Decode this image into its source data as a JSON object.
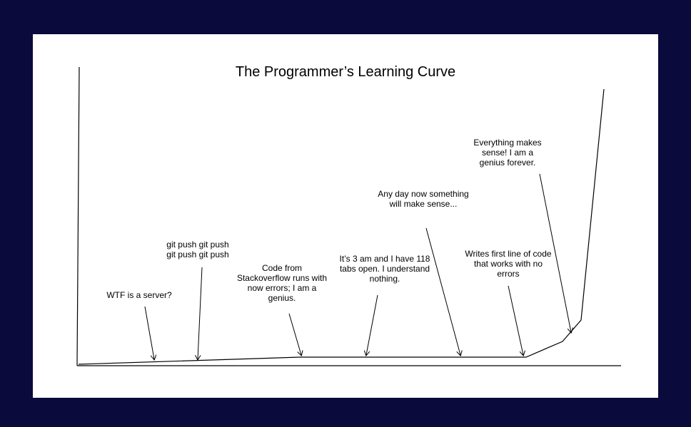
{
  "title": "The Programmer’s Learning Curve",
  "annotations": [
    "WTF is a server?",
    "git push git push\ngit push git push",
    "Code from\nStackoverflow runs with\nnow errors; I am a\ngenius.",
    "It’s 3 am and I have 118\ntabs open. I understand\nnothing.",
    "Any day now something\nwill make sense...",
    "Writes first line of code\nthat works with no\nerrors",
    "Everything makes\nsense! I am a\ngenius forever."
  ],
  "colors": {
    "background": "#0b0a3c",
    "panel": "#ffffff",
    "ink": "#000000"
  }
}
